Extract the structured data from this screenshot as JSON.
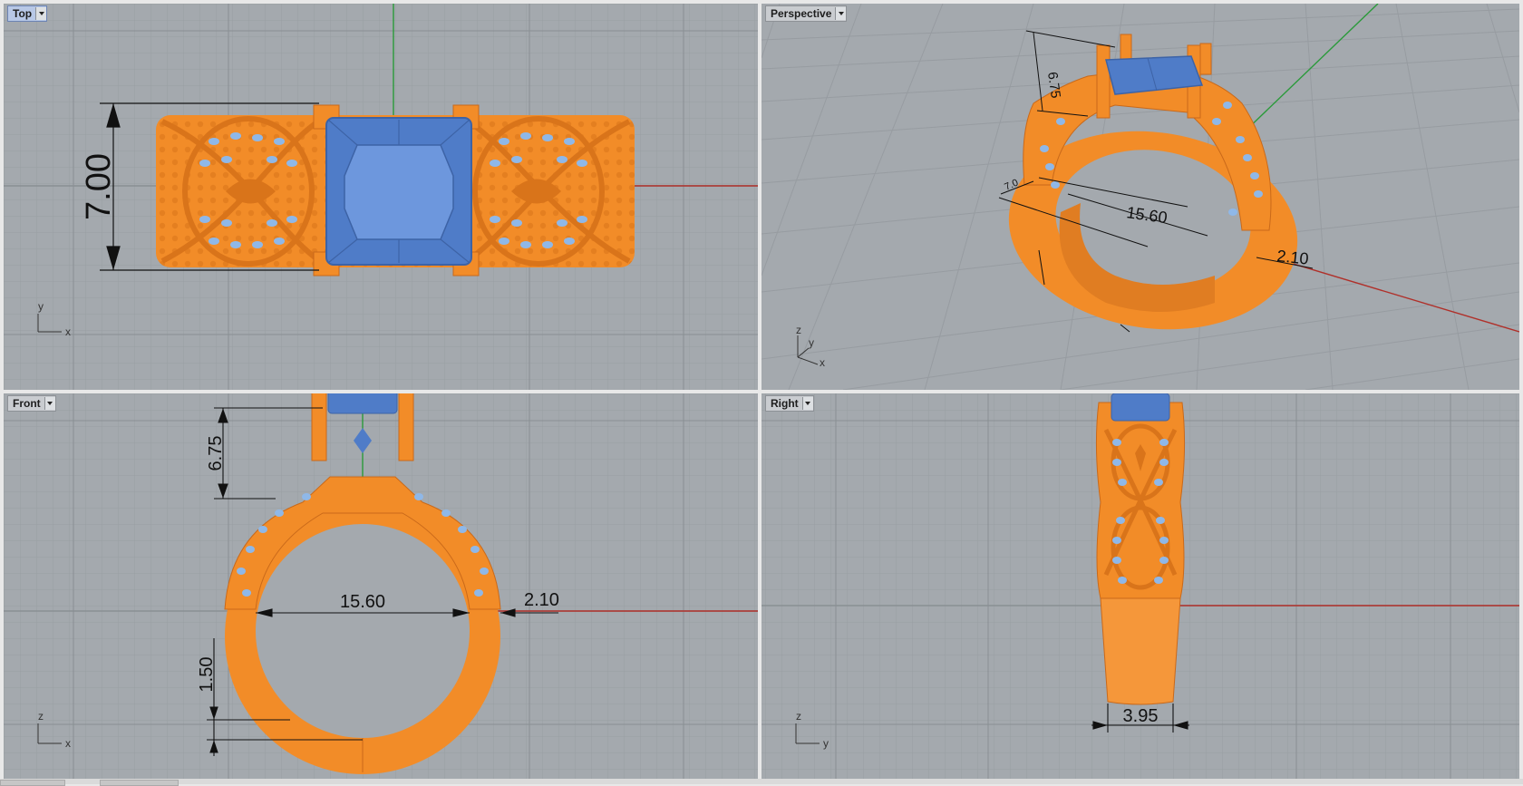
{
  "viewports": {
    "top": {
      "label": "Top",
      "dim_width": "7.00",
      "axis_v": "y",
      "axis_h": "x"
    },
    "perspective": {
      "label": "Perspective",
      "dim_height": "6.75",
      "dim_width": "15.60",
      "dim_thick": "2.10",
      "dim_small": "7.0",
      "axis_z": "z",
      "axis_y": "y",
      "axis_x": "x"
    },
    "front": {
      "label": "Front",
      "dim_height": "6.75",
      "dim_inner": "15.60",
      "dim_thick": "2.10",
      "dim_base": "1.50",
      "axis_v": "z",
      "axis_h": "x"
    },
    "right": {
      "label": "Right",
      "dim_width": "3.95",
      "axis_v": "z",
      "axis_h": "y"
    }
  },
  "colors": {
    "metal": "#f28c28",
    "gem": "#5b86d0",
    "stones": "#8fb8e8",
    "viewport_bg": "#a4a9ae",
    "grid_minor": "#999ea3",
    "grid_major": "#8c9196",
    "axis_x": "#b0302a",
    "axis_y": "#2a9a3a"
  },
  "icons": {
    "viewport_menu": "chevron-down-icon"
  }
}
